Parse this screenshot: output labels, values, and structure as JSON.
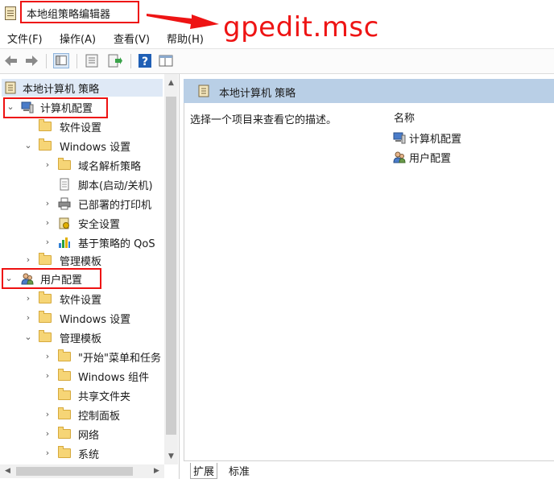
{
  "window": {
    "title": "本地组策略编辑器",
    "annotation": "gpedit.msc"
  },
  "menu": [
    "文件(F)",
    "操作(A)",
    "查看(V)",
    "帮助(H)"
  ],
  "toolbar": {
    "icons": [
      "back-icon",
      "forward-icon",
      "show-tree-icon",
      "properties-icon",
      "export-list-icon",
      "help-icon",
      "view-icon"
    ]
  },
  "tree": {
    "root": "本地计算机 策略",
    "computer_config": "计算机配置",
    "computer_children": {
      "software": "软件设置",
      "windows_settings": "Windows 设置",
      "windows_children": [
        "域名解析策略",
        "脚本(启动/关机)",
        "已部署的打印机",
        "安全设置",
        "基于策略的 QoS"
      ],
      "admin_templates": "管理模板"
    },
    "user_config": "用户配置",
    "user_children": {
      "software": "软件设置",
      "windows_settings": "Windows 设置",
      "admin_templates": "管理模板",
      "admin_children": [
        "\"开始\"菜单和任务",
        "Windows 组件",
        "共享文件夹",
        "控制面板",
        "网络",
        "系统"
      ]
    }
  },
  "right_pane": {
    "header": "本地计算机 策略",
    "description": "选择一个项目来查看它的描述。",
    "column_header": "名称",
    "items": [
      "计算机配置",
      "用户配置"
    ]
  },
  "tabs": [
    "扩展",
    "标准"
  ],
  "colors": {
    "highlight_red": "#ee1414",
    "header_blue": "#b9cfe6",
    "selected_row": "#dfe9f6"
  }
}
